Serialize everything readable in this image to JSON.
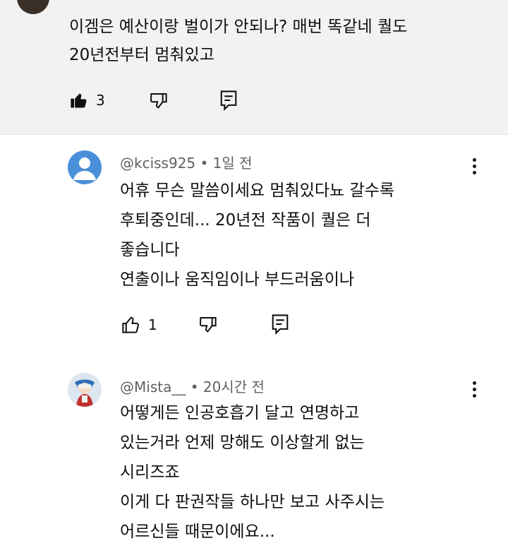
{
  "top_comment": {
    "lines": [
      "이겜은 예산이랑 벌이가 안되나? 매번 똑같네 퀄도",
      "20년전부터 멈춰있고"
    ],
    "like_count": "3"
  },
  "replies": [
    {
      "handle": "@kciss925",
      "time": "1일 전",
      "lines": [
        "어휴 무슨 말씀이세요 멈춰있다뇨 갈수록",
        "후퇴중인데... 20년전 작품이 퀄은 더",
        "좋습니다",
        "연출이나 움직임이나 부드러움이나"
      ],
      "like_count": "1",
      "avatar_color": "#4a90d9"
    },
    {
      "handle": "@Mista__",
      "time": "20시간 전",
      "lines": [
        "어떻게든 인공호흡기 달고 연명하고",
        "있는거라 언제 망해도 이상할게 없는",
        "시리즈죠",
        "이게 다 판권작들 하나만 보고 사주시는",
        "어르신들 때문이에요..."
      ]
    }
  ],
  "meta_separator": "•",
  "icons": [
    "like-icon",
    "dislike-icon",
    "reply-icon",
    "more-icon"
  ]
}
